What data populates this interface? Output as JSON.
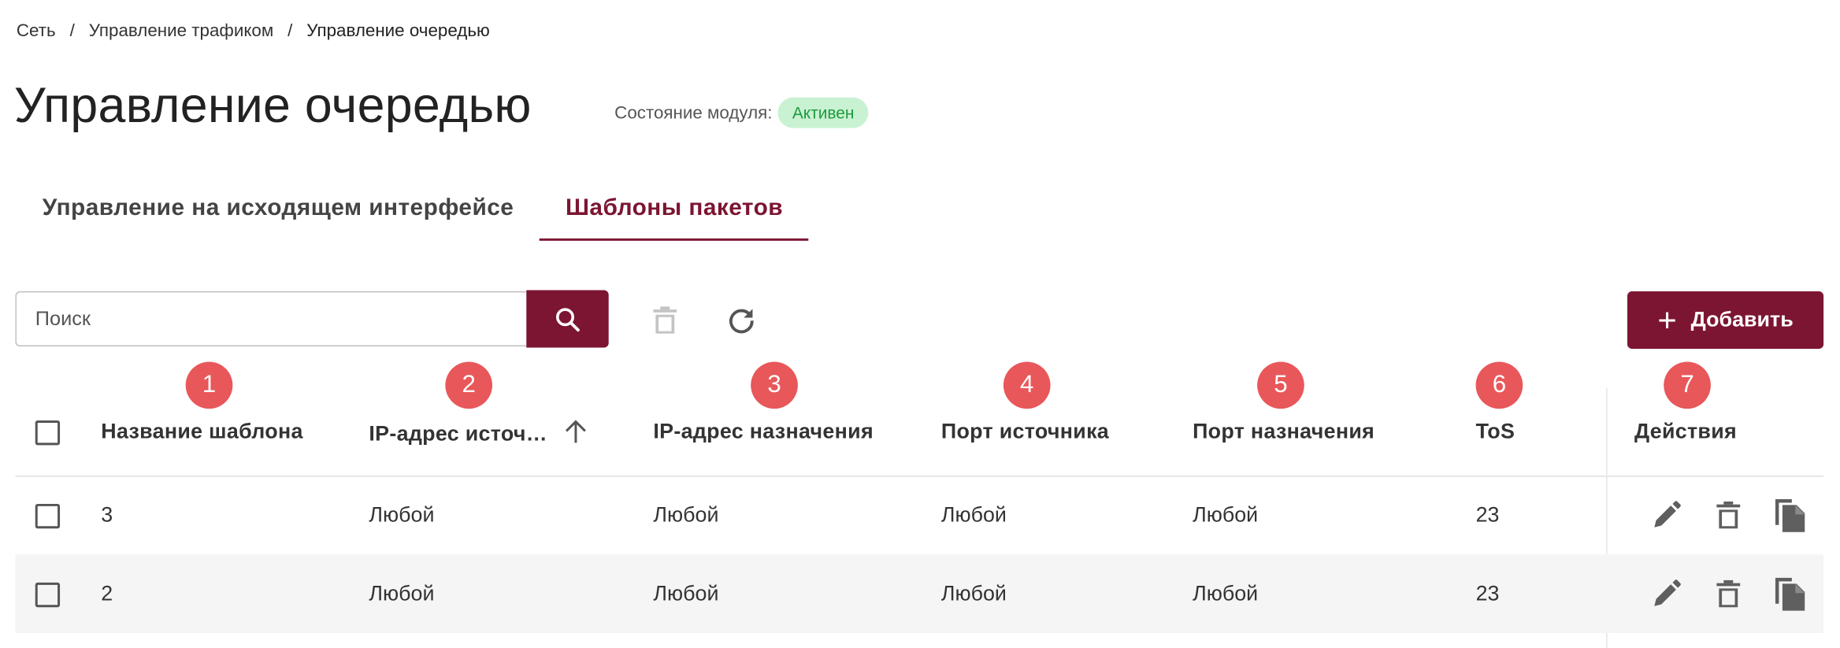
{
  "breadcrumb": {
    "items": [
      "Сеть",
      "Управление трафиком",
      "Управление очередью"
    ],
    "separator": "/"
  },
  "page": {
    "title": "Управление очередью",
    "module_state_label": "Состояние модуля:",
    "module_state_value": "Активен"
  },
  "tabs": [
    {
      "label": "Управление на исходящем интерфейсе",
      "active": false
    },
    {
      "label": "Шаблоны пакетов",
      "active": true
    }
  ],
  "toolbar": {
    "search_placeholder": "Поиск",
    "add_label": "Добавить",
    "icons": [
      "search-icon",
      "delete-icon",
      "refresh-icon",
      "plus-icon"
    ]
  },
  "markers": [
    "1",
    "2",
    "3",
    "4",
    "5",
    "6",
    "7"
  ],
  "table": {
    "columns": [
      "Название шаблона",
      "IP-адрес источ…",
      "IP-адрес назначения",
      "Порт источника",
      "Порт назначения",
      "ToS",
      "Действия"
    ],
    "sorted_column": "IP-адрес источ…",
    "sort_direction": "ascending",
    "rows": [
      [
        "3",
        "Любой",
        "Любой",
        "Любой",
        "Любой",
        "23"
      ],
      [
        "2",
        "Любой",
        "Любой",
        "Любой",
        "Любой",
        "23"
      ]
    ],
    "row_actions": [
      "edit-icon",
      "delete-icon",
      "copy-icon"
    ]
  },
  "colors": {
    "accent": "#7c1532",
    "status_bg": "#c9f2d2",
    "status_text": "#1e9a3e",
    "marker": "#e8575a",
    "row_alt": "#f5f5f5"
  }
}
